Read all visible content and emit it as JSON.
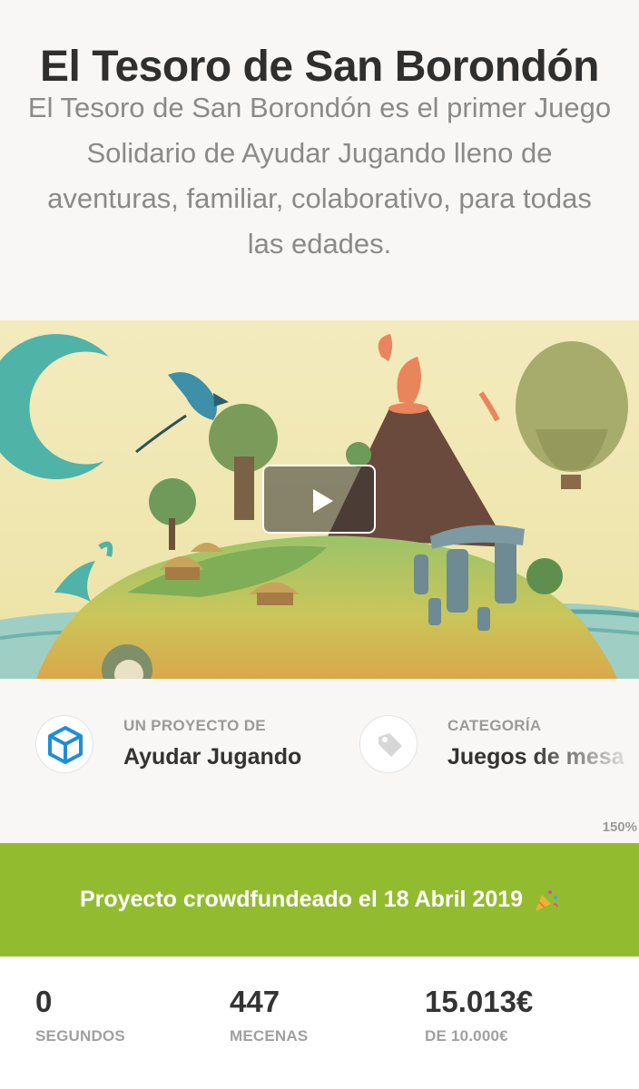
{
  "project": {
    "title": "El Tesoro de San Borondón",
    "description": "El Tesoro de San Borondón es el primer Juego Solidario de Ayudar Jugando lleno de aventuras, familiar, colaborativo, para todas las edades."
  },
  "video": {
    "play_icon": "play-icon"
  },
  "meta": {
    "creator_label": "UN PROYECTO DE",
    "creator_name": "Ayudar Jugando",
    "creator_icon": "cube-logo-icon",
    "category_label": "CATEGORÍA",
    "category_value": "Juegos de mesa",
    "category_icon": "tag-icon"
  },
  "zoom_level": "150%",
  "banner": {
    "text": "Proyecto crowdfundeado el 18 Abril 2019",
    "icon": "party-popper-icon"
  },
  "stats": [
    {
      "value": "0",
      "label": "SEGUNDOS"
    },
    {
      "value": "447",
      "label": "MECENAS"
    },
    {
      "value": "15.013€",
      "label": "DE 10.000€"
    }
  ],
  "colors": {
    "banner_bg": "#93bb2f",
    "logo_blue": "#1e8fd6"
  }
}
